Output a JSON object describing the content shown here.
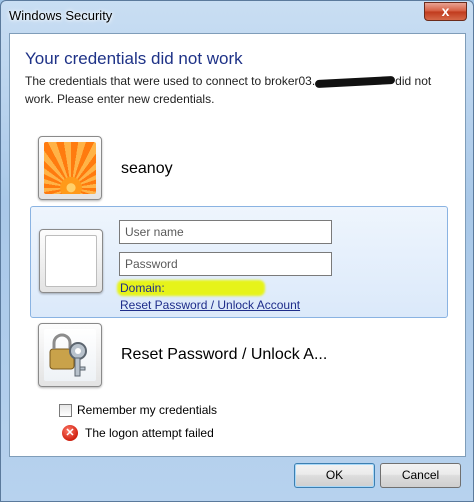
{
  "window": {
    "title": "Windows Security",
    "close_glyph": "x"
  },
  "header": {
    "title": "Your credentials did not work",
    "message_part1": "The credentials that were used to connect to broker03.",
    "message_part2": "did not work. Please enter new credentials."
  },
  "tiles": [
    {
      "name": "seanoy",
      "icon": "flower-icon"
    },
    {
      "name": "",
      "icon": "user-blank-icon"
    },
    {
      "name": "Reset Password / Unlock A...",
      "icon": "keys-lock-icon"
    }
  ],
  "form": {
    "username_placeholder": "User name",
    "password_placeholder": "Password",
    "domain_label": "Domain:",
    "reset_link": "Reset Password / Unlock Account",
    "highlight_color": "#e6f31a"
  },
  "remember": {
    "label": "Remember my credentials",
    "checked": false
  },
  "error": {
    "text": "The logon attempt failed",
    "icon": "error-icon",
    "icon_glyph": "✕"
  },
  "buttons": {
    "ok": "OK",
    "cancel": "Cancel"
  }
}
